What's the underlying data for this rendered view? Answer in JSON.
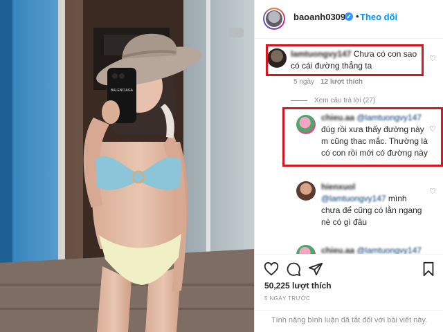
{
  "post": {
    "photo_icon": "photo-of-woman-taking-mirror-selfie",
    "phone_case_text": "BALENCIAGA"
  },
  "header": {
    "username": "baoanh0309",
    "verified_icon": "verified-badge-icon",
    "separator": "•",
    "follow_label": "Theo dõi"
  },
  "comments": [
    {
      "username": "lamtuongvy147",
      "text": "Chưa có con sao có cái đường thẳng ta",
      "time": "5 ngày",
      "likes": "12 lượt thích",
      "view_replies": "Xem câu trả lời (27)"
    },
    {
      "username": "chieu.aa",
      "mention": "@lamtuongvy147",
      "text": "đúg rồi xưa thấy đường này m cũng thac mắc. Thường là có con rồi mới có đường này"
    },
    {
      "username": "hienxuol",
      "mention": "@lamtuongvy147",
      "text": "mình chưa để cũng có lằn ngang nè có gì đâu"
    },
    {
      "username": "chieu.aa",
      "mention": "@lamtuongvy147"
    }
  ],
  "actions": {
    "like_icon": "heart-icon",
    "comment_icon": "comment-icon",
    "share_icon": "paper-plane-icon",
    "save_icon": "bookmark-icon",
    "likes_count": "50,225 lượt thích",
    "time_ago": "5 NGÀY TRƯỚC",
    "comments_disabled": "Tính năng bình luận đã tắt đối với bài viết này."
  },
  "colors": {
    "accent_blue": "#0095f6",
    "highlight_red": "#d9161d",
    "muted_text": "#8e8e8e"
  }
}
